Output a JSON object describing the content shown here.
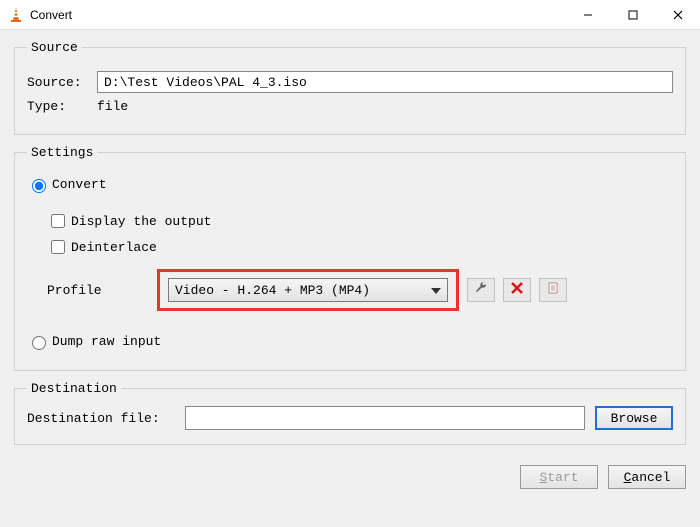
{
  "window": {
    "title": "Convert"
  },
  "source_section": {
    "legend": "Source",
    "source_label": "Source:",
    "source_value": "D:\\Test Videos\\PAL 4_3.iso",
    "type_label": "Type:",
    "type_value": "file"
  },
  "settings_section": {
    "legend": "Settings",
    "convert_label": "Convert",
    "display_output_label": "Display the output",
    "deinterlace_label": "Deinterlace",
    "profile_label": "Profile",
    "profile_value": "Video - H.264 + MP3 (MP4)",
    "dump_raw_label": "Dump raw input"
  },
  "destination_section": {
    "legend": "Destination",
    "dest_file_label": "Destination file:",
    "dest_file_value": "",
    "browse_label": "Browse"
  },
  "footer": {
    "start_label": "Start",
    "cancel_label": "Cancel"
  }
}
